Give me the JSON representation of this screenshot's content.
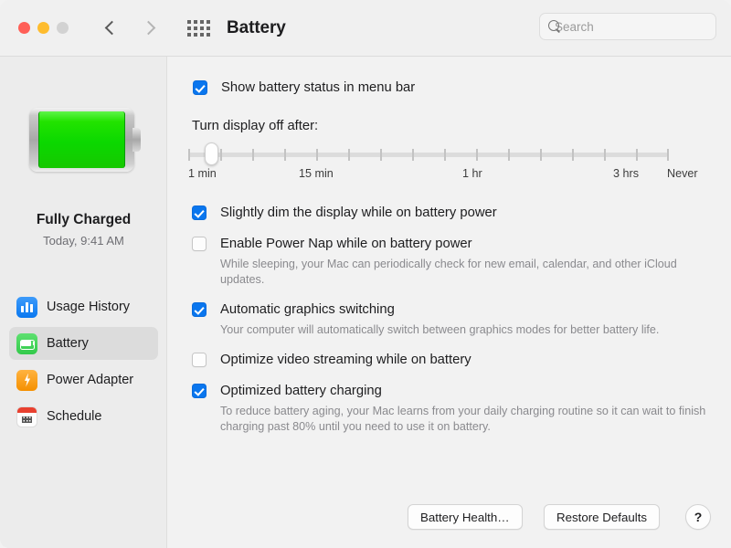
{
  "window": {
    "title": "Battery",
    "traffic_lights": [
      "close",
      "minimize",
      "zoom"
    ],
    "nav": {
      "back": "back-chevron",
      "forward": "forward-chevron",
      "grid": "show-all-grid"
    }
  },
  "search": {
    "placeholder": "Search",
    "value": "",
    "icon": "search-icon"
  },
  "sidebar": {
    "battery_icon": "battery-full-green",
    "charge_status": "Fully Charged",
    "charge_time": "Today, 9:41 AM",
    "items": [
      {
        "label": "Usage History",
        "icon": "usage-history-icon",
        "selected": false
      },
      {
        "label": "Battery",
        "icon": "battery-icon",
        "selected": true
      },
      {
        "label": "Power Adapter",
        "icon": "power-adapter-icon",
        "selected": false
      },
      {
        "label": "Schedule",
        "icon": "schedule-calendar-icon",
        "selected": false
      }
    ]
  },
  "main": {
    "menu_bar_option": {
      "label": "Show battery status in menu bar",
      "checked": true
    },
    "slider": {
      "label": "Turn display off after:",
      "tick_labels": [
        "1 min",
        "15 min",
        "1 hr",
        "3 hrs",
        "Never"
      ],
      "tick_count": 16,
      "value": "1 min",
      "thumb_position_percent": 3
    },
    "options": [
      {
        "label": "Slightly dim the display while on battery power",
        "checked": true,
        "description": ""
      },
      {
        "label": "Enable Power Nap while on battery power",
        "checked": false,
        "description": "While sleeping, your Mac can periodically check for new email, calendar, and other iCloud updates."
      },
      {
        "label": "Automatic graphics switching",
        "checked": true,
        "description": "Your computer will automatically switch between graphics modes for better battery life."
      },
      {
        "label": "Optimize video streaming while on battery",
        "checked": false,
        "description": ""
      },
      {
        "label": "Optimized battery charging",
        "checked": true,
        "description": "To reduce battery aging, your Mac learns from your daily charging routine so it can wait to finish charging past 80% until you need to use it on battery."
      }
    ]
  },
  "footer": {
    "battery_health_label": "Battery Health…",
    "restore_defaults_label": "Restore Defaults",
    "help_label": "?"
  },
  "colors": {
    "accent_blue": "#0a76ee",
    "battery_green": "#22e300",
    "sidebar_bg": "#ececec",
    "content_bg": "#f2f2f2",
    "selected_row": "#dcdcdc"
  }
}
